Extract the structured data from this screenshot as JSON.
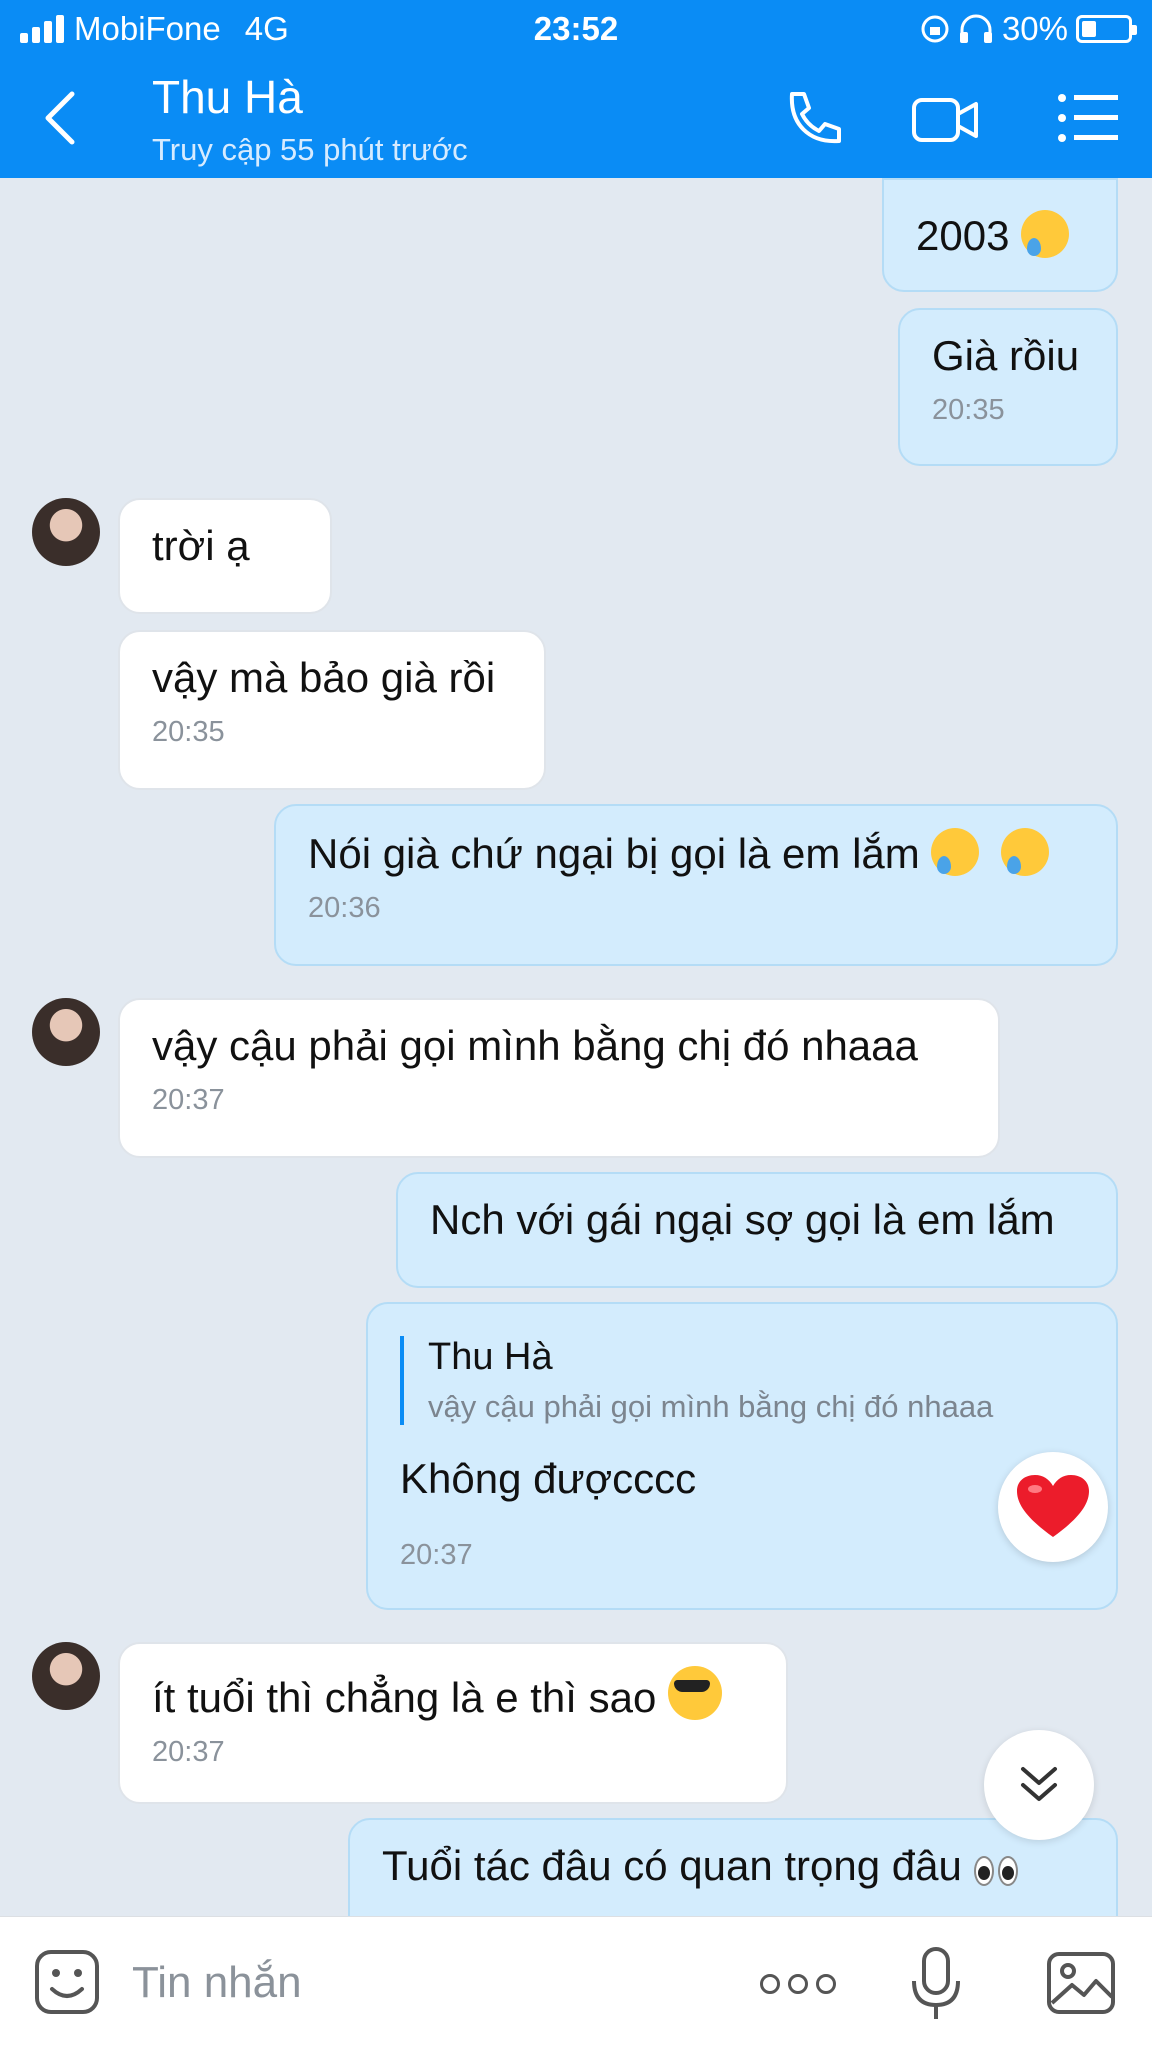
{
  "status_bar": {
    "carrier": "MobiFone",
    "network": "4G",
    "time": "23:52",
    "battery": "30%"
  },
  "header": {
    "contact_name": "Thu Hà",
    "contact_status": "Truy cập 55 phút trước",
    "accent_color": "#0a8cf5"
  },
  "messages": [
    {
      "text": "2003",
      "emoji": "crying-face"
    },
    {
      "text": "Già rồiu",
      "time": "20:35"
    },
    {
      "text": "trời ạ"
    },
    {
      "text": "vậy mà bảo già rồi",
      "time": "20:35"
    },
    {
      "text": "Nói già chứ ngại bị gọi là em lắm",
      "emoji": "crying-face",
      "time": "20:36"
    },
    {
      "text": "vậy cậu phải gọi mình bằng chị đó nhaaa",
      "time": "20:37"
    },
    {
      "text": "Nch với gái ngại sợ gọi là em lắm"
    },
    {
      "quote_name": "Thu Hà",
      "quote_text": "vậy cậu phải gọi mình bằng chị đó nhaaa",
      "text": "Không đượcccc",
      "time": "20:37",
      "reaction": "heart"
    },
    {
      "text": "ít tuổi thì chẳng là e thì sao",
      "emoji": "sunglasses-face",
      "time": "20:37"
    },
    {
      "text": "Tuổi tác đâu có quan trọng đâu",
      "emoji": "eyes"
    }
  ],
  "input": {
    "placeholder": "Tin nhắn"
  }
}
